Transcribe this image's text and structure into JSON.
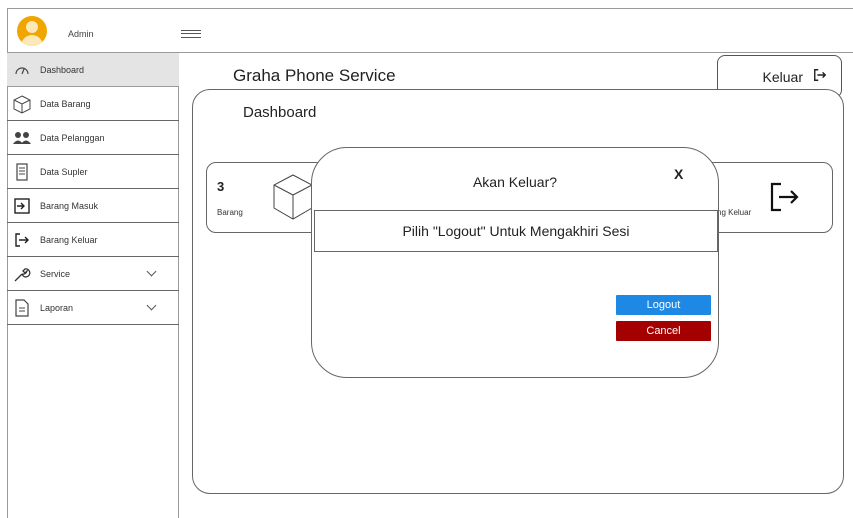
{
  "header": {
    "user": "Admin"
  },
  "sidebar": {
    "items": [
      {
        "label": "Dashboard",
        "icon": "dashboard-icon"
      },
      {
        "label": "Data Barang",
        "icon": "cube-icon"
      },
      {
        "label": "Data Pelanggan",
        "icon": "users-icon"
      },
      {
        "label": "Data Supler",
        "icon": "building-icon"
      },
      {
        "label": "Barang Masuk",
        "icon": "sign-in-icon"
      },
      {
        "label": "Barang Keluar",
        "icon": "sign-out-icon"
      },
      {
        "label": "Service",
        "icon": "wrench-icon"
      },
      {
        "label": "Laporan",
        "icon": "document-icon"
      }
    ]
  },
  "main": {
    "app_title": "Graha Phone Service",
    "logout_label": "Keluar",
    "section_title": "Dashboard",
    "cards": [
      {
        "value": "3",
        "label": "Barang"
      },
      {
        "label": "ng Keluar"
      }
    ]
  },
  "modal": {
    "title": "Akan Keluar?",
    "close": "X",
    "message": "Pilih \"Logout\" Untuk Mengakhiri Sesi",
    "primary_label": "Logout",
    "danger_label": "Cancel"
  },
  "colors": {
    "primary": "#1e88e5",
    "danger": "#a40000",
    "avatar": "#f0a500"
  }
}
